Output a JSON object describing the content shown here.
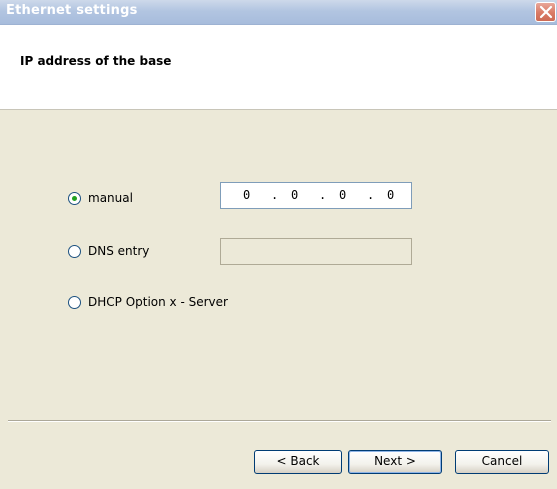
{
  "window": {
    "title": "Ethernet settings"
  },
  "header": {
    "title": "IP address of the base"
  },
  "options": {
    "manual": {
      "label": "manual",
      "selected": true
    },
    "dns": {
      "label": "DNS entry",
      "selected": false
    },
    "dhcp": {
      "label": "DHCP Option x - Server",
      "selected": false
    }
  },
  "ip": {
    "octets": [
      "0",
      "0",
      "0",
      "0"
    ],
    "separator": "."
  },
  "dns_field": {
    "value": ""
  },
  "buttons": {
    "back": "< Back",
    "next": "Next >",
    "cancel": "Cancel"
  },
  "colors": {
    "radio_dot": "#21a121",
    "close_button": "#d97a65",
    "title_bar": "#b2c5e1"
  }
}
